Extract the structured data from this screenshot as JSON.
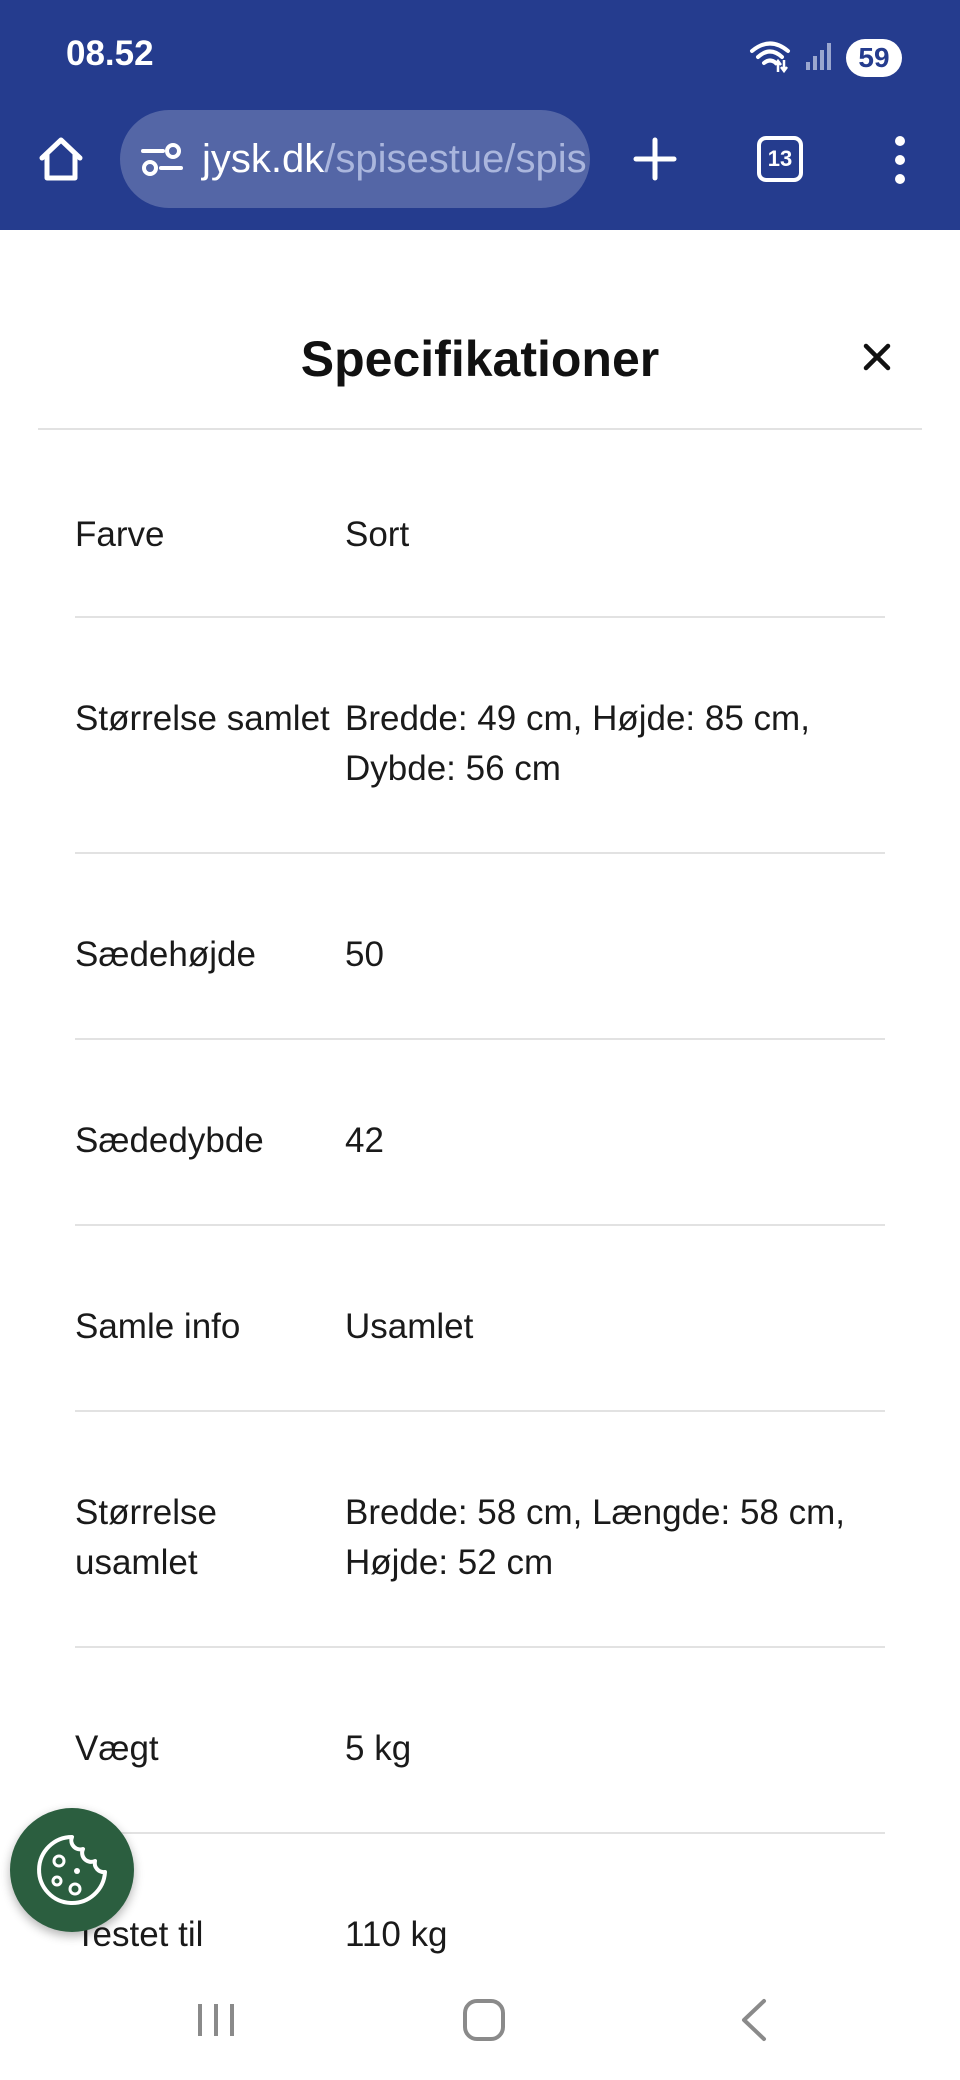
{
  "status_bar": {
    "time": "08.52",
    "battery": "59",
    "icons": [
      "wifi-icon",
      "signal-icon",
      "battery-icon"
    ]
  },
  "browser": {
    "url_domain": "jysk.dk",
    "url_path": "/spisestue/spis",
    "tab_count": "13",
    "icons": [
      "home-icon",
      "site-settings-icon",
      "plus-icon",
      "tabs-icon",
      "more-menu-icon"
    ],
    "toolbar_color": "#253c8e"
  },
  "sheet": {
    "title": "Specifikationer",
    "close_icon": "close-icon"
  },
  "specs": [
    {
      "label": "Farve",
      "value": "Sort"
    },
    {
      "label": "Størrelse samlet",
      "value": "Bredde: 49 cm, Højde: 85 cm, Dybde: 56 cm"
    },
    {
      "label": "Sædehøjde",
      "value": "50"
    },
    {
      "label": "Sædedybde",
      "value": "42"
    },
    {
      "label": "Samle info",
      "value": "Usamlet"
    },
    {
      "label": "Størrelse usamlet",
      "value": "Bredde: 58 cm, Længde: 58 cm, Højde: 52 cm"
    },
    {
      "label": "Vægt",
      "value": "5 kg"
    },
    {
      "label": "Testet til",
      "value": "110 kg"
    }
  ],
  "cookie_button": {
    "icon": "cookie-icon",
    "color": "#2b5e3f"
  },
  "nav_bar": {
    "icons": [
      "recent-apps-icon",
      "home-nav-icon",
      "back-icon"
    ]
  }
}
